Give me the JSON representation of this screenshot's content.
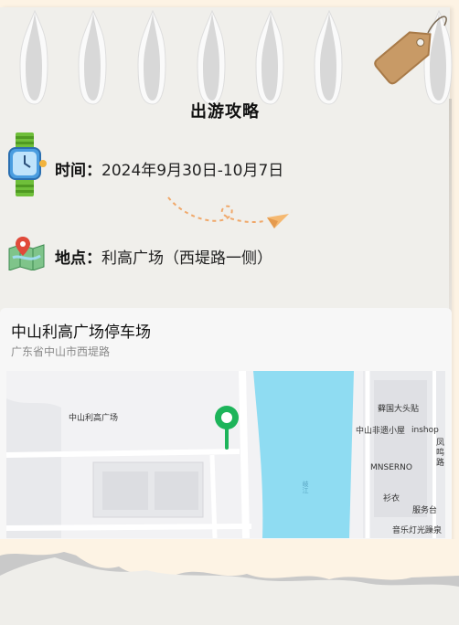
{
  "title": "出游攻略",
  "time": {
    "label": "时间：",
    "value": "2024年9月30日-10月7日"
  },
  "location": {
    "label": "地点：",
    "value": "利高广场（西堤路一侧）"
  },
  "map_card": {
    "name": "中山利高广场停车场",
    "address": "广东省中山市西堤路",
    "labels": {
      "plaza": "中山利高广场",
      "shop1": "藓国大头贴",
      "shop2": "中山非遗小屋",
      "shop3": "inshop",
      "shop4": "MNSERNO",
      "shop5": "衫衣",
      "shop6": "服务台",
      "shop7": "音乐灯光躁泉",
      "road": "凤鸣路",
      "river": "岐江"
    }
  },
  "colors": {
    "paper": "#f0efeb",
    "river": "#8fdcf2",
    "pin": "#1db45a",
    "tag": "#c89a66"
  }
}
